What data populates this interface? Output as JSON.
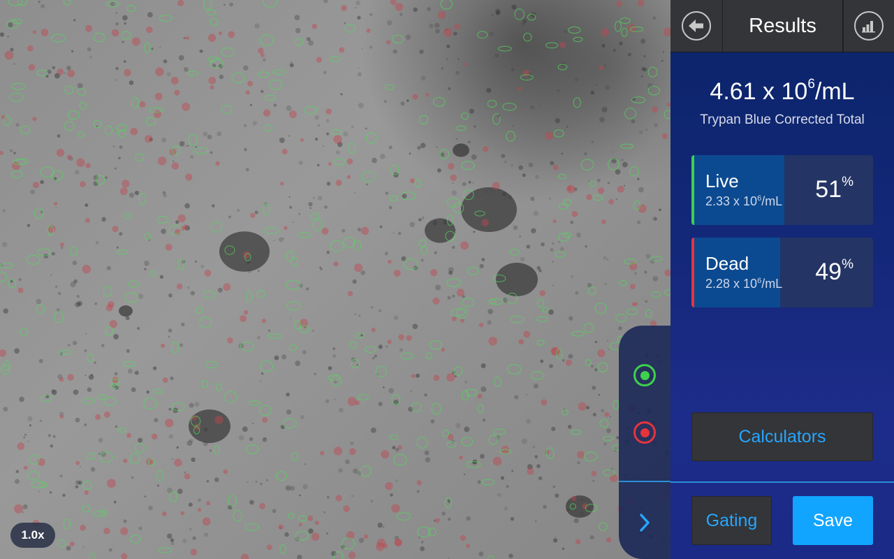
{
  "image": {
    "zoom_label": "1.0x"
  },
  "overlay": {
    "live_toggle_icon": "radio-live-icon",
    "dead_toggle_icon": "radio-dead-icon",
    "expand_icon": "chevron-right-icon",
    "live_color": "#3dd24c",
    "dead_color": "#e6343c"
  },
  "header": {
    "title": "Results",
    "back_icon": "arrow-left-icon",
    "stats_icon": "bar-chart-icon"
  },
  "summary": {
    "total_base": "4.61 x 10",
    "total_exp": "6",
    "total_unit": "/mL",
    "total_label": "Trypan Blue Corrected Total"
  },
  "results": {
    "live": {
      "name": "Live",
      "conc_base": "2.33 x 10",
      "conc_exp": "6",
      "conc_unit": "/mL",
      "percent": "51",
      "percent_sign": "%"
    },
    "dead": {
      "name": "Dead",
      "conc_base": "2.28 x 10",
      "conc_exp": "6",
      "conc_unit": "/mL",
      "percent": "49",
      "percent_sign": "%"
    }
  },
  "actions": {
    "calculators_label": "Calculators",
    "gating_label": "Gating",
    "save_label": "Save",
    "accent_color": "#12a5ff"
  }
}
